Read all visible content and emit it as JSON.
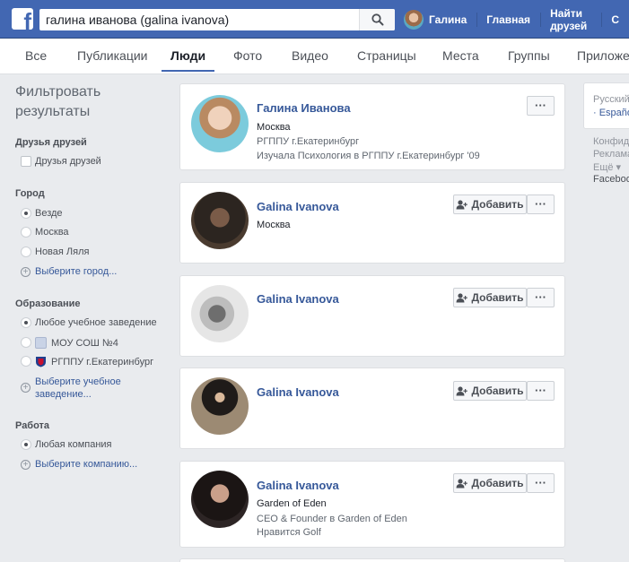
{
  "search": {
    "query": "галина иванова (galina ivanova)"
  },
  "header": {
    "user_name": "Галина",
    "home": "Главная",
    "find_friends": "Найти друзей",
    "overflow": "С"
  },
  "tabs": [
    "Все",
    "Публикации",
    "Люди",
    "Фото",
    "Видео",
    "Страницы",
    "Места",
    "Группы",
    "Приложения"
  ],
  "active_tab": "Люди",
  "filters": {
    "title_line1": "Фильтровать",
    "title_line2": "результаты",
    "friends": {
      "heading": "Друзья друзей",
      "option": "Друзья друзей"
    },
    "city": {
      "heading": "Город",
      "options": [
        "Везде",
        "Москва",
        "Новая Ляля"
      ],
      "choose": "Выберите город..."
    },
    "education": {
      "heading": "Образование",
      "options": [
        "Любое учебное заведение",
        "МОУ СОШ №4",
        "РГППУ г.Екатеринбург"
      ],
      "choose_line1": "Выберите учебное",
      "choose_line2": "заведение..."
    },
    "work": {
      "heading": "Работа",
      "options": [
        "Любая компания"
      ],
      "choose": "Выберите компанию..."
    }
  },
  "results": [
    {
      "name": "Галина Иванова",
      "lines": [
        "Москва",
        "РГППУ г.Екатеринбург",
        "Изучала Психология в РГППУ г.Екатеринбург '09"
      ],
      "add": false
    },
    {
      "name": "Galina Ivanova",
      "lines": [
        "Москва"
      ],
      "add": true
    },
    {
      "name": "Galina Ivanova",
      "lines": [],
      "add": true
    },
    {
      "name": "Galina Ivanova",
      "lines": [],
      "add": true
    },
    {
      "name": "Galina Ivanova",
      "lines": [
        "Garden of Eden",
        "CEO & Founder в Garden of Eden",
        "Нравится Golf"
      ],
      "add": true
    }
  ],
  "buttons": {
    "add_friend": "Добавить",
    "more": "···"
  },
  "rail": {
    "lang_current": "Русский",
    "lang_other": "· Españo",
    "links": [
      "Конфид",
      "Реклама",
      "Ещё ▾"
    ],
    "facebook": "Faceboo"
  },
  "colors": {
    "brand": "#4267b2",
    "link": "#365899",
    "background": "#e9ebee"
  }
}
